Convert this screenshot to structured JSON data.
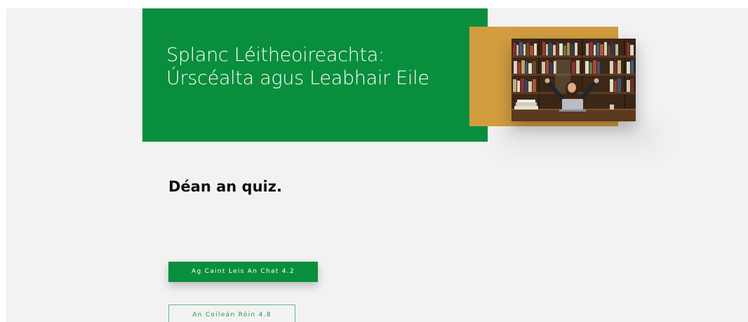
{
  "hero": {
    "title": "Splanc Léitheoireachta:\nÚrscéalta agus Leabhair Eile",
    "image_alt": "person-celebrating-at-laptop-in-library-photo"
  },
  "quiz": {
    "heading": "Déan an quiz."
  },
  "buttons": [
    {
      "label": "Ag Caint Leis An Chat 4.2"
    },
    {
      "label": "An Coileán Róin 4.8"
    }
  ],
  "colors": {
    "brand_green": "#088e3d",
    "accent_gold": "#d19d3f",
    "background": "#f2f2f2"
  }
}
